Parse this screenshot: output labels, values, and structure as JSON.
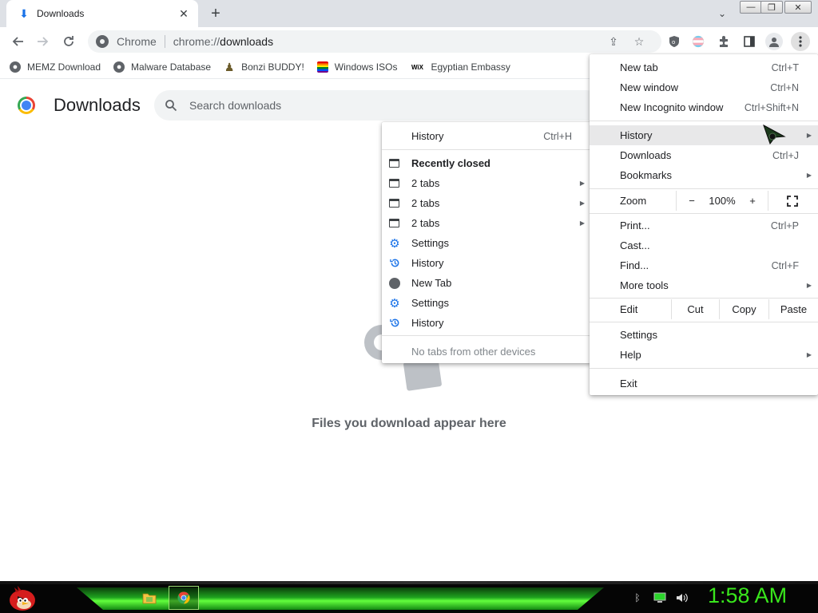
{
  "tab": {
    "title": "Downloads",
    "close_glyph": "✕"
  },
  "window_controls": {
    "minimize": "—",
    "maximize": "❐",
    "close": "✕"
  },
  "toolbar": {
    "site_chip": "Chrome",
    "url_scheme": "chrome://",
    "url_host": "downloads"
  },
  "bookmarks": [
    {
      "label": "MEMZ Download",
      "icon": "globe-icon"
    },
    {
      "label": "Malware Database",
      "icon": "globe-icon"
    },
    {
      "label": "Bonzi BUDDY!",
      "icon": "bonzi-icon"
    },
    {
      "label": "Windows ISOs",
      "icon": "rainbow-flag-icon"
    },
    {
      "label": "Egyptian Embassy",
      "icon": "wix-icon",
      "icon_text": "WiX"
    }
  ],
  "page": {
    "title": "Downloads",
    "search_placeholder": "Search downloads",
    "empty_message": "Files you download appear here"
  },
  "app_menu": {
    "new_tab": {
      "label": "New tab",
      "shortcut": "Ctrl+T"
    },
    "new_window": {
      "label": "New window",
      "shortcut": "Ctrl+N"
    },
    "new_incognito": {
      "label": "New Incognito window",
      "shortcut": "Ctrl+Shift+N"
    },
    "history": {
      "label": "History"
    },
    "downloads": {
      "label": "Downloads",
      "shortcut": "Ctrl+J"
    },
    "bookmarks": {
      "label": "Bookmarks"
    },
    "zoom": {
      "label": "Zoom",
      "minus": "−",
      "value": "100%",
      "plus": "+"
    },
    "print": {
      "label": "Print...",
      "shortcut": "Ctrl+P"
    },
    "cast": {
      "label": "Cast..."
    },
    "find": {
      "label": "Find...",
      "shortcut": "Ctrl+F"
    },
    "more_tools": {
      "label": "More tools"
    },
    "edit": {
      "label": "Edit",
      "cut": "Cut",
      "copy": "Copy",
      "paste": "Paste"
    },
    "settings": {
      "label": "Settings"
    },
    "help": {
      "label": "Help"
    },
    "exit": {
      "label": "Exit"
    }
  },
  "history_menu": {
    "history": {
      "label": "History",
      "shortcut": "Ctrl+H"
    },
    "recently_closed": "Recently closed",
    "items": [
      {
        "label": "2 tabs",
        "icon": "window-icon",
        "submenu": true
      },
      {
        "label": "2 tabs",
        "icon": "window-icon",
        "submenu": true
      },
      {
        "label": "2 tabs",
        "icon": "window-icon",
        "submenu": true
      },
      {
        "label": "Settings",
        "icon": "gear-icon"
      },
      {
        "label": "History",
        "icon": "history-icon"
      },
      {
        "label": "New Tab",
        "icon": "globe-icon"
      },
      {
        "label": "Settings",
        "icon": "gear-icon"
      },
      {
        "label": "History",
        "icon": "history-icon"
      }
    ],
    "no_tabs": "No tabs from other devices"
  },
  "taskbar": {
    "clock": "1:58 AM"
  },
  "colors": {
    "accent": "#1a73e8",
    "clock": "#39e61c",
    "taskbar_glow": "#62ff3c"
  }
}
